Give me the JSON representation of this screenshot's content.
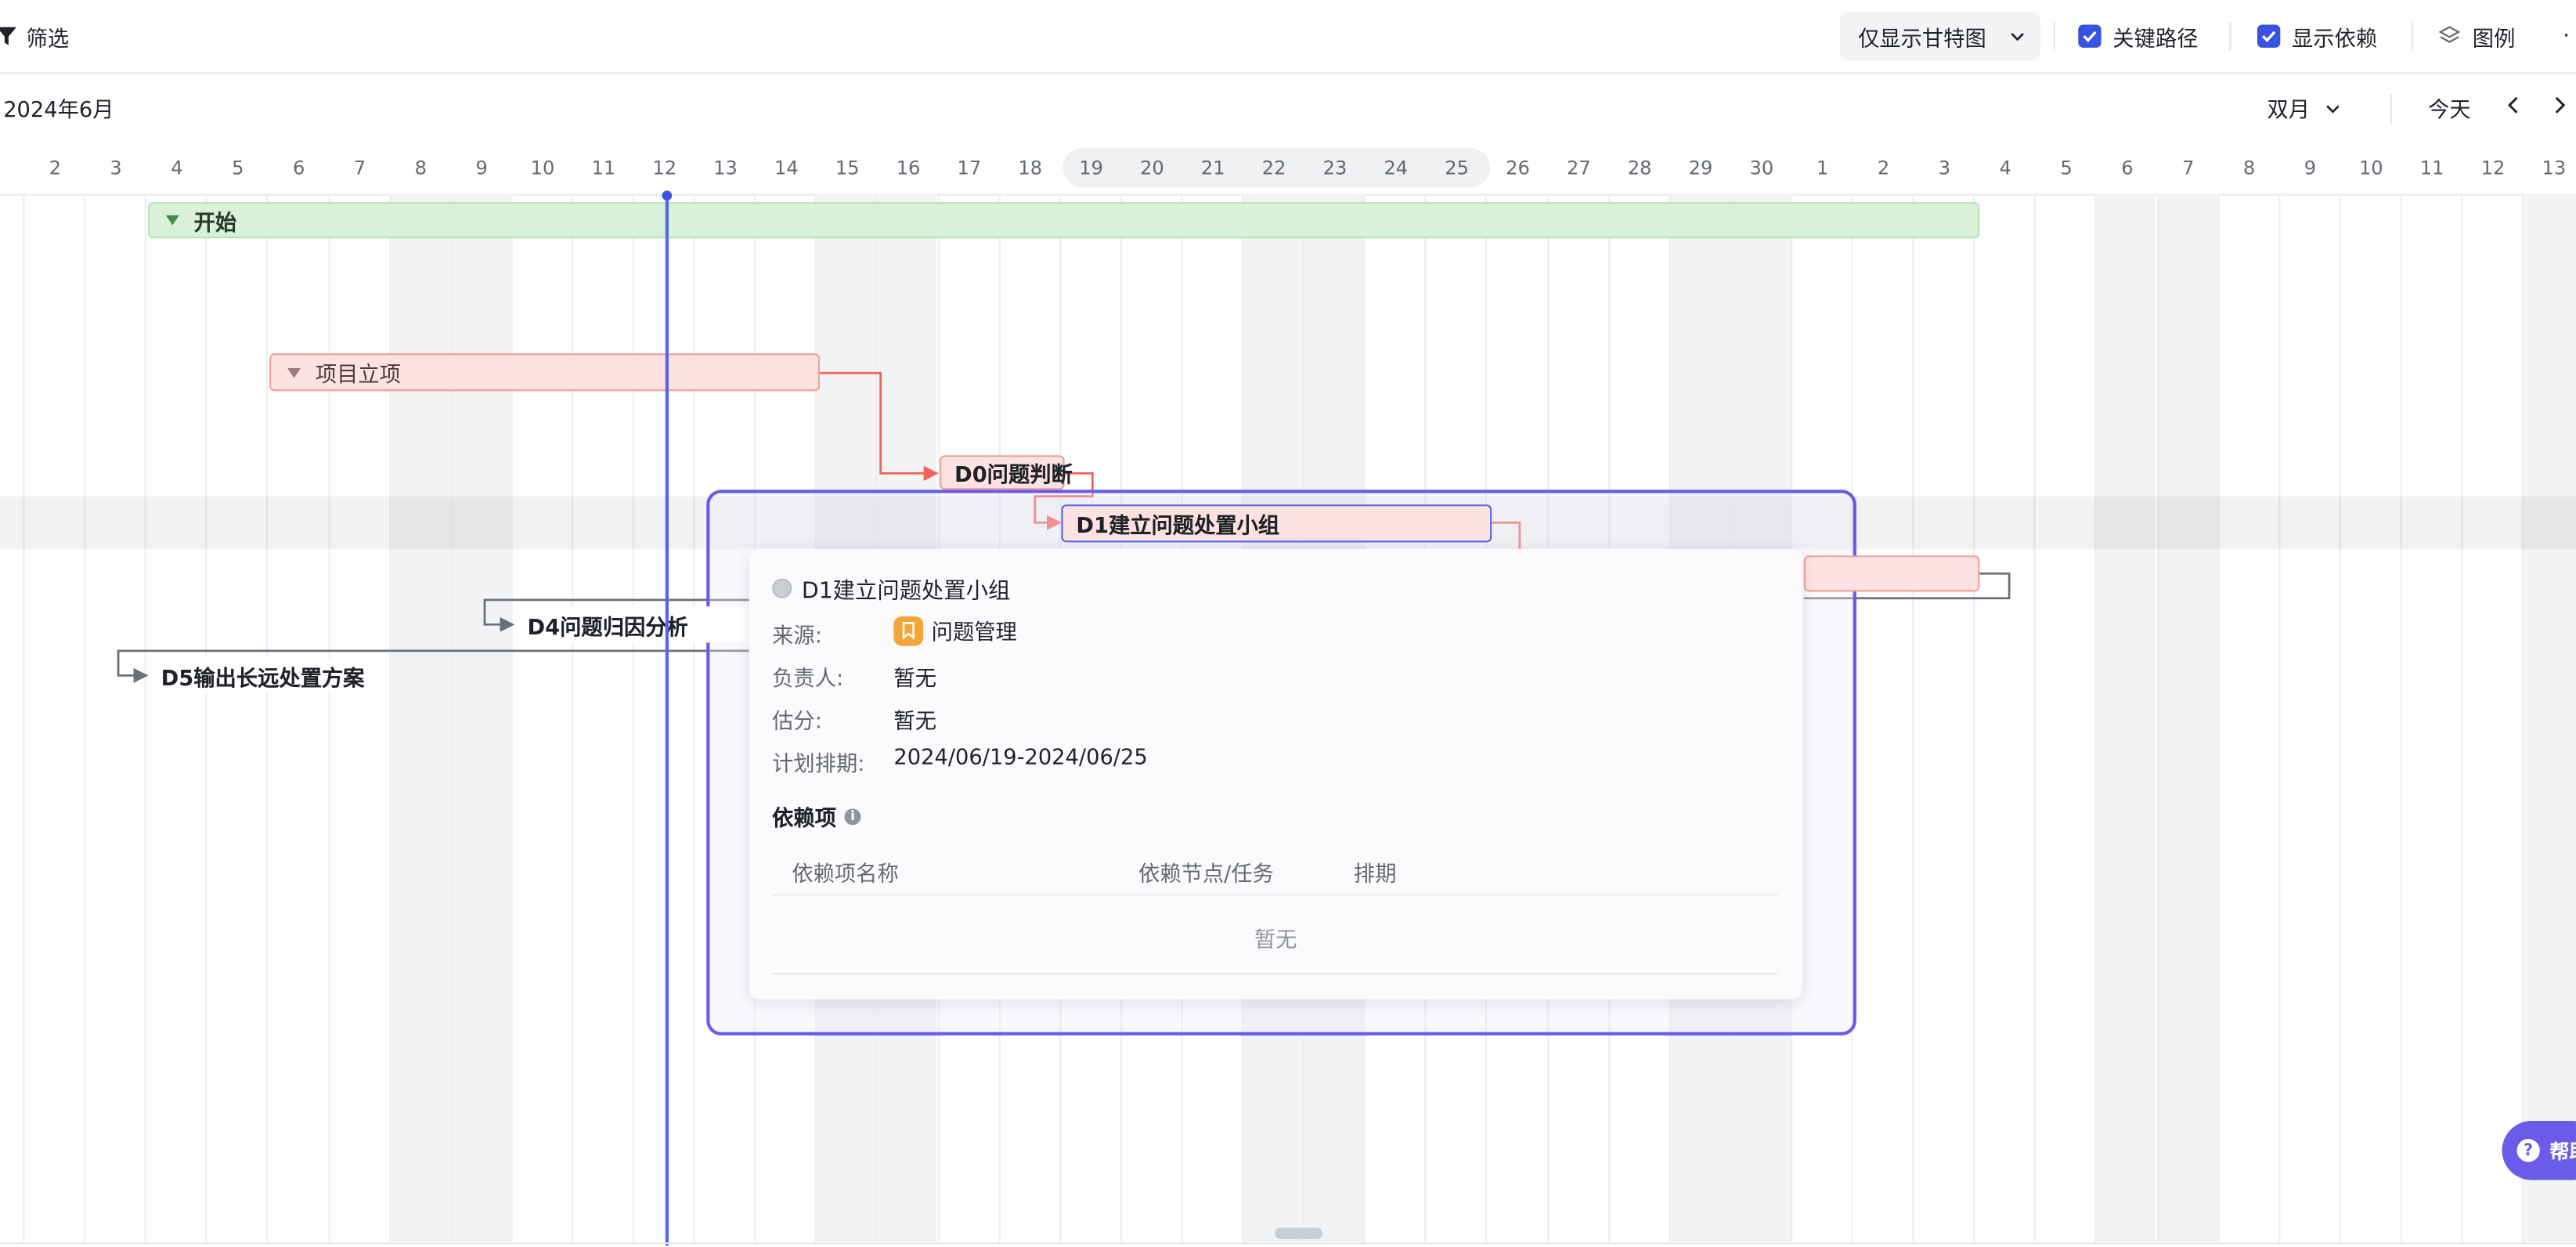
{
  "toolbar": {
    "filter_label": "筛选",
    "view_select": "仅显示甘特图",
    "critical_path": {
      "label": "关键路径",
      "checked": true
    },
    "show_deps": {
      "label": "显示依赖",
      "checked": true
    },
    "legend_label": "图例",
    "more": "·",
    "accent_color": "#3853e0"
  },
  "timeline": {
    "month_label": "2024年6月",
    "range_select": "双月",
    "today_label": "今天",
    "days": [
      "2",
      "3",
      "4",
      "5",
      "6",
      "7",
      "8",
      "9",
      "10",
      "11",
      "12",
      "13",
      "14",
      "15",
      "16",
      "17",
      "18",
      "19",
      "20",
      "21",
      "22",
      "23",
      "24",
      "25",
      "26",
      "27",
      "28",
      "29",
      "30",
      "1",
      "2",
      "3",
      "4",
      "5",
      "6",
      "7",
      "8",
      "9",
      "10",
      "11",
      "12",
      "13"
    ],
    "highlighted_days": [
      "19",
      "20",
      "21",
      "22",
      "23",
      "24",
      "25"
    ],
    "today": "12"
  },
  "tasks": [
    {
      "name": "开始",
      "type": "group",
      "color": "#d9f1d9"
    },
    {
      "name": "项目立项",
      "type": "group",
      "color": "#fde2e1"
    },
    {
      "name": "D0问题判断",
      "type": "task",
      "critical": true
    },
    {
      "name": "D1建立问题处置小组",
      "type": "task",
      "critical": true,
      "selected": true
    },
    {
      "name": "D4问题归因分析",
      "type": "task"
    },
    {
      "name": "D5输出长远处置方案",
      "type": "task"
    }
  ],
  "popup": {
    "title": "D1建立问题处置小组",
    "source_key": "来源:",
    "source_value": "问题管理",
    "owner_key": "负责人:",
    "owner_value": "暂无",
    "estimate_key": "估分:",
    "estimate_value": "暂无",
    "schedule_key": "计划排期:",
    "schedule_value": "2024/06/19-2024/06/25",
    "deps_title": "依赖项",
    "deps_columns": [
      "依赖项名称",
      "依赖节点/任务",
      "排期"
    ],
    "deps_empty": "暂无"
  },
  "help": {
    "label": "帮助",
    "color": "#6a5ce8"
  }
}
